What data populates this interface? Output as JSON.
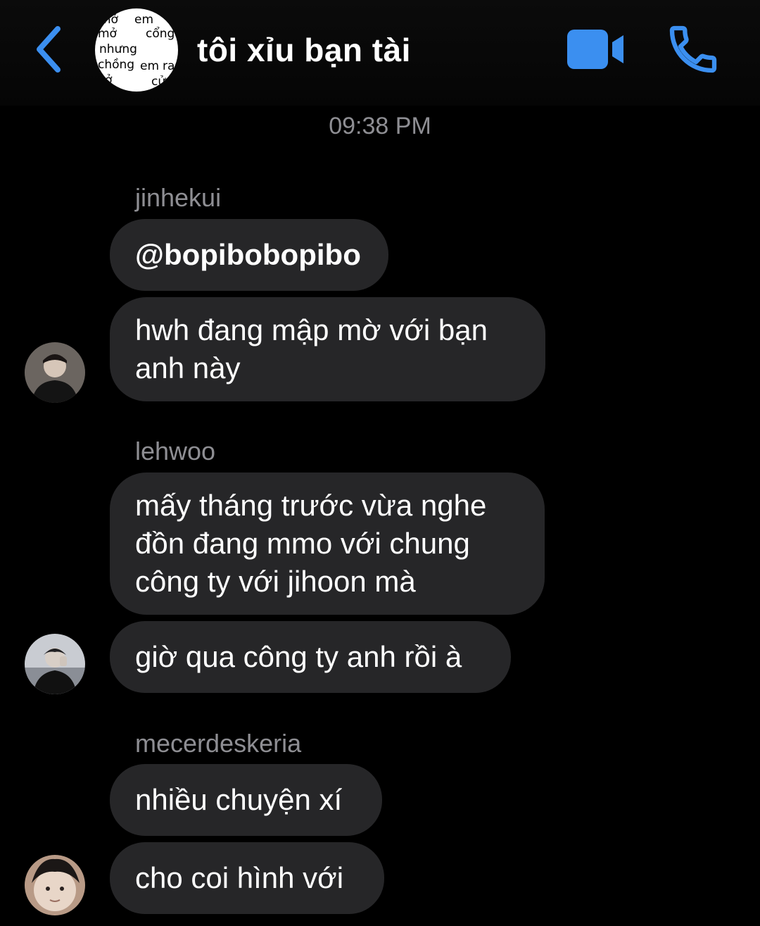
{
  "header": {
    "title": "tôi xỉu bạn tài",
    "group_avatar_text": [
      "mở",
      "em",
      "mở",
      "cổng",
      "nhưng",
      "chồng",
      "em",
      "ra",
      "ở",
      "cử"
    ]
  },
  "icons": {
    "back": "chevron-left-icon",
    "video": "video-camera-icon",
    "call": "phone-icon",
    "accent": "#3b8ff0"
  },
  "chat": {
    "timestamp": "09:38 PM",
    "groups": [
      {
        "sender": "jinhekui",
        "messages": [
          "@bopibobopibo",
          "hwh đang mập mờ với bạn anh này"
        ]
      },
      {
        "sender": "lehwoo",
        "messages": [
          "mấy tháng trước vừa nghe đồn đang mmo với chung công ty với jihoon mà",
          "giờ qua công ty anh rồi à"
        ]
      },
      {
        "sender": "mecerdeskeria",
        "messages": [
          "nhiều chuyện xí",
          "cho coi hình với"
        ]
      }
    ]
  }
}
